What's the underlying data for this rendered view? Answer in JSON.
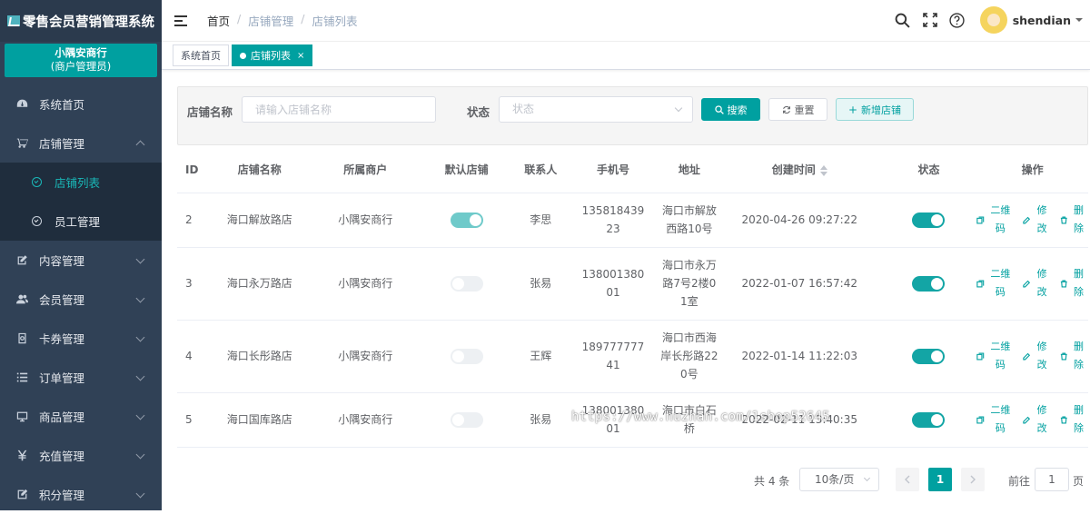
{
  "app": {
    "title": "零售会员营销管理系统"
  },
  "merchant": {
    "name": "小隅安商行",
    "role": "(商户管理员)"
  },
  "sidebar": {
    "items": [
      {
        "label": "系统首页",
        "icon": "dashboard-icon"
      },
      {
        "label": "店铺管理",
        "icon": "cart-icon",
        "expanded": true
      },
      {
        "label": "店铺列表",
        "icon": "check-circle-icon",
        "active": true
      },
      {
        "label": "员工管理",
        "icon": "check-circle-icon"
      },
      {
        "label": "内容管理",
        "icon": "edit-icon"
      },
      {
        "label": "会员管理",
        "icon": "users-icon"
      },
      {
        "label": "卡券管理",
        "icon": "coupon-icon"
      },
      {
        "label": "订单管理",
        "icon": "list-icon"
      },
      {
        "label": "商品管理",
        "icon": "monitor-icon"
      },
      {
        "label": "充值管理",
        "icon": "yen-icon"
      },
      {
        "label": "积分管理",
        "icon": "edit-square-icon"
      }
    ]
  },
  "header": {
    "breadcrumb": [
      "首页",
      "店铺管理",
      "店铺列表"
    ],
    "sep": "/",
    "username": "shendian"
  },
  "tags": [
    {
      "label": "系统首页"
    },
    {
      "label": "店铺列表",
      "close": "×"
    }
  ],
  "filter": {
    "name_label": "店铺名称",
    "name_placeholder": "请输入店铺名称",
    "status_label": "状态",
    "status_placeholder": "状态",
    "search": "搜索",
    "reset": "重置",
    "add": "新增店铺"
  },
  "table": {
    "headers": [
      "ID",
      "店铺名称",
      "所属商户",
      "默认店铺",
      "联系人",
      "手机号",
      "地址",
      "创建时间",
      "状态",
      "操作"
    ],
    "rows": [
      {
        "id": "2",
        "name": "海口解放路店",
        "merchant": "小隅安商行",
        "default": true,
        "contact": "李思",
        "phone": "13581843923",
        "address": "海口市解放西路10号",
        "created": "2020-04-26 09:27:22",
        "status": true
      },
      {
        "id": "3",
        "name": "海口永万路店",
        "merchant": "小隅安商行",
        "default": false,
        "contact": "张易",
        "phone": "13800138001",
        "address": "海口市永万路7号2楼01室",
        "created": "2022-01-07 16:57:42",
        "status": true
      },
      {
        "id": "4",
        "name": "海口长彤路店",
        "merchant": "小隅安商行",
        "default": false,
        "contact": "王辉",
        "phone": "18977777741",
        "address": "海口市西海岸长彤路220号",
        "created": "2022-01-14 11:22:03",
        "status": true
      },
      {
        "id": "5",
        "name": "海口国库路店",
        "merchant": "小隅安商行",
        "default": false,
        "contact": "张易",
        "phone": "13800138001",
        "address": "海口市白石桥",
        "created": "2022-02-11 13:40:35",
        "status": true
      }
    ],
    "ops": {
      "qrcode": "二维码",
      "edit": "修改",
      "delete": "删除"
    }
  },
  "pagination": {
    "total": "共 4 条",
    "page_size": "10条/页",
    "current": "1",
    "goto_label": "前往",
    "goto_value": "1",
    "page_unit": "页"
  },
  "watermark": "https://www.huzhan.com/1shop52645",
  "colors": {
    "accent": "#00a0a0",
    "sidebar": "#304156"
  }
}
